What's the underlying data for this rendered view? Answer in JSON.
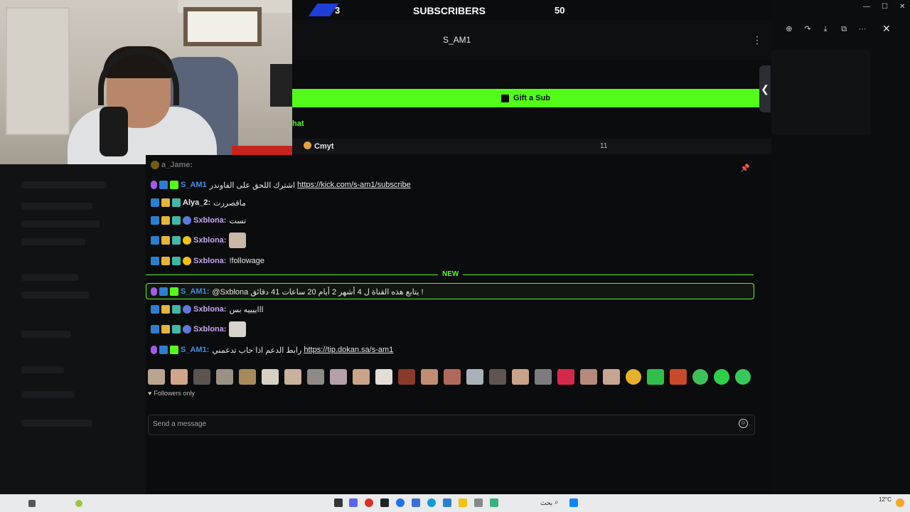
{
  "stream_overlay": {
    "subscriber_count": "3",
    "subscriber_label": "SUBSCRIBERS",
    "subscriber_goal": "50"
  },
  "channel": {
    "name": "S_AM1",
    "gift_button_label": "Gift a Sub",
    "chat_tab_label": "hat",
    "top_viewer_name": "Cmyt",
    "top_viewer_count": "11"
  },
  "chat": {
    "partial_top": "a_Jame:",
    "messages": [
      {
        "user": "S_AM1",
        "text": "اشترك اللحق على الفاوندر",
        "link": "https://kick.com/s-am1/subscribe",
        "color": "#3f8ee6"
      },
      {
        "user": "Alya_2:",
        "text": "ماقصررت",
        "color": "#e8e8e8"
      },
      {
        "user": "Sxblona:",
        "text": "تست",
        "color": "#c6a6ef"
      },
      {
        "user": "Sxblona:",
        "text": "",
        "color": "#c6a6ef"
      },
      {
        "user": "Sxblona:",
        "text": "!followage",
        "color": "#c6a6ef"
      },
      {
        "user": "S_AM1:",
        "text": "@Sxblona يتابع هذه القناة ل 4 أشهر 2 أيام 20 ساعات 41 دقائق !",
        "color": "#3f8ee6"
      },
      {
        "user": "Sxblona:",
        "text": "اااييييه بس",
        "color": "#c6a6ef"
      },
      {
        "user": "Sxblona:",
        "text": "",
        "color": "#c6a6ef"
      },
      {
        "user": "S_AM1:",
        "text": "رابط الدعم اذا حاب تدعمني",
        "link": "https://tip.dokan.sa/s-am1",
        "color": "#3f8ee6"
      }
    ],
    "new_separator_label": "NEW",
    "followers_only_label": "Followers only",
    "input_placeholder": "Send a message"
  },
  "taskbar": {
    "search_label": "بحث",
    "temperature": "12°C"
  },
  "colors": {
    "accent": "#53fc18",
    "background": "#0b0c0e",
    "subscriber_stripe": "#1f3fd8"
  }
}
